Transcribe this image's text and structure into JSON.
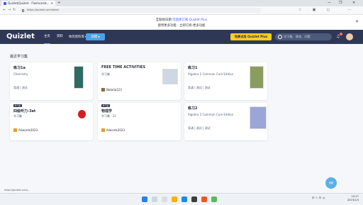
{
  "browser": {
    "tab_title": "Quizlet|Quizlet - Flashcards...",
    "url": "https://quizlet.com/latest",
    "tab_close": "✕",
    "new_tab": "+",
    "window_controls": [
      "—",
      "❐",
      "✕"
    ]
  },
  "notice": {
    "line1_prefix": "互联网日期",
    "line1_link": "可选择订阅 Quizlet Plus",
    "line2": "使用更多功能 · 立即订阅·更多功能",
    "close": "✕"
  },
  "nav": {
    "logo": "Quizlet",
    "home": "主页",
    "library": "资料",
    "your_library": "你的资料库",
    "create": "创建",
    "upgrade": "免费试用 Quizlet Plus",
    "search_placeholder": "学习集、课本、问题"
  },
  "main": {
    "section_title": "最近学习集",
    "cards": [
      {
        "title": "练习1a",
        "subtitle": "Chemistry",
        "actions": "背诵 | 测试"
      },
      {
        "title": "FREE TIME ACTIVITIES",
        "subtitle": "学习集",
        "author": "Natalia123"
      },
      {
        "title": "练习1",
        "subtitle": "Algebra 2 Common Core Edition",
        "actions": "背诵 | 测试 | 测试"
      },
      {
        "tag": "学习集",
        "title": "四级听力-3at",
        "subtitle": "学习集",
        "author": "Aliwords2023"
      },
      {
        "tag": "学习集",
        "title": "物理学",
        "subtitle": "学习集 · 22",
        "author": "Alwords2023"
      },
      {
        "title": "练习2",
        "subtitle": "Algebra 2 Common Core Edition",
        "actions": "背诵 | 测试 | 测试"
      }
    ]
  },
  "status_text": "https://quizlet.com/...",
  "fab_label": "帮助",
  "taskbar": {
    "tray": "中 へ 令 ◁)",
    "time": "10:27",
    "date": "2023/1/4"
  },
  "colors": {
    "nav_bg": "#2e3856",
    "accent": "#4255ff",
    "upgrade_bg": "#ffcd1f",
    "create_bg": "#4aa3e8"
  }
}
